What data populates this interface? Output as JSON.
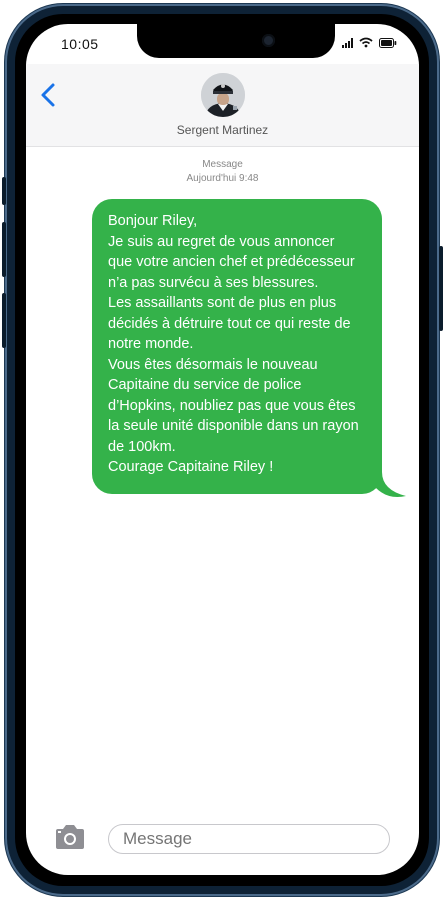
{
  "status_bar": {
    "time": "10:05"
  },
  "header": {
    "contact_name": "Sergent Martinez",
    "back_icon": "chevron-left-icon"
  },
  "conversation": {
    "service_label": "Message",
    "timestamp": "Aujourd'hui 9:48",
    "messages": [
      {
        "direction": "outgoing",
        "lines": [
          "Bonjour Riley,",
          "Je suis au regret de vous annoncer",
          "que votre ancien chef et prédécesseur",
          "n’a pas survécu à ses blessures.",
          "Les assaillants sont de plus en plus",
          "décidés à détruire tout ce qui reste de",
          "notre monde.",
          "Vous êtes désormais le nouveau",
          "Capitaine du service de police",
          "d’Hopkins, noubliez pas que vous êtes",
          "la seule unité disponible dans un rayon",
          "de 100km.",
          "Courage Capitaine Riley !"
        ]
      }
    ]
  },
  "compose": {
    "placeholder": "Message",
    "camera_icon": "camera-icon"
  },
  "colors": {
    "bubble": "#34b24a",
    "accent": "#1a73e8",
    "frame": "#0e2236"
  }
}
